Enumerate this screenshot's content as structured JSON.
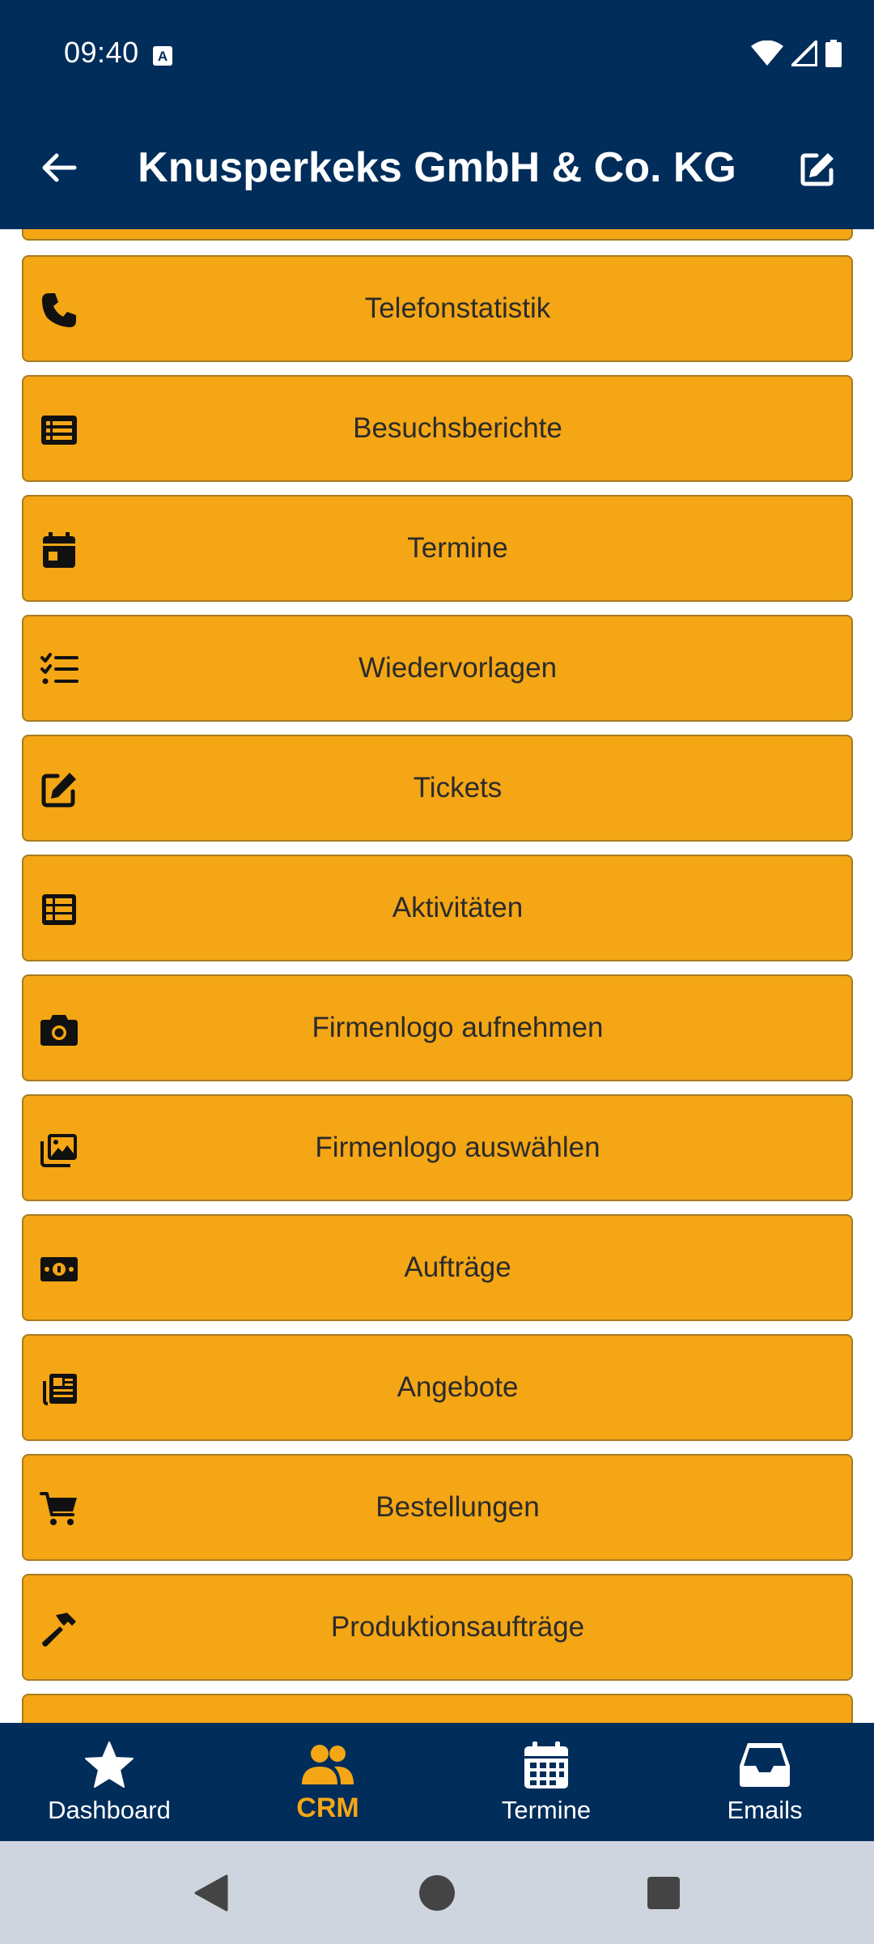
{
  "status_bar": {
    "time": "09:40",
    "notification_icon": "text-a-icon",
    "icons": [
      "wifi-icon",
      "signal-icon",
      "battery-icon"
    ]
  },
  "app_bar": {
    "title": "Knusperkeks GmbH & Co. KG",
    "back_icon": "arrow-left-icon",
    "edit_icon": "edit-icon"
  },
  "menu": {
    "items": [
      {
        "label": "Telefonstatistik",
        "icon": "phone-icon"
      },
      {
        "label": "Besuchsberichte",
        "icon": "list-alt-icon"
      },
      {
        "label": "Termine",
        "icon": "calendar-day-icon"
      },
      {
        "label": "Wiedervorlagen",
        "icon": "tasks-icon"
      },
      {
        "label": "Tickets",
        "icon": "edit-icon"
      },
      {
        "label": "Aktivitäten",
        "icon": "table-list-icon"
      },
      {
        "label": "Firmenlogo aufnehmen",
        "icon": "camera-icon"
      },
      {
        "label": "Firmenlogo auswählen",
        "icon": "images-icon"
      },
      {
        "label": "Aufträge",
        "icon": "money-bill-icon"
      },
      {
        "label": "Angebote",
        "icon": "newspaper-icon"
      },
      {
        "label": "Bestellungen",
        "icon": "cart-icon"
      },
      {
        "label": "Produktionsaufträge",
        "icon": "hammer-icon"
      }
    ]
  },
  "bottom_nav": {
    "items": [
      {
        "label": "Dashboard",
        "icon": "star-icon",
        "active": false
      },
      {
        "label": "CRM",
        "icon": "users-icon",
        "active": true
      },
      {
        "label": "Termine",
        "icon": "calendar-icon",
        "active": false
      },
      {
        "label": "Emails",
        "icon": "inbox-icon",
        "active": false
      }
    ]
  },
  "colors": {
    "header_bg": "#002d5a",
    "item_bg": "#f4a615",
    "item_border": "#a87b20",
    "active_nav": "#f4a615",
    "system_nav_bg": "#cfd5de"
  }
}
